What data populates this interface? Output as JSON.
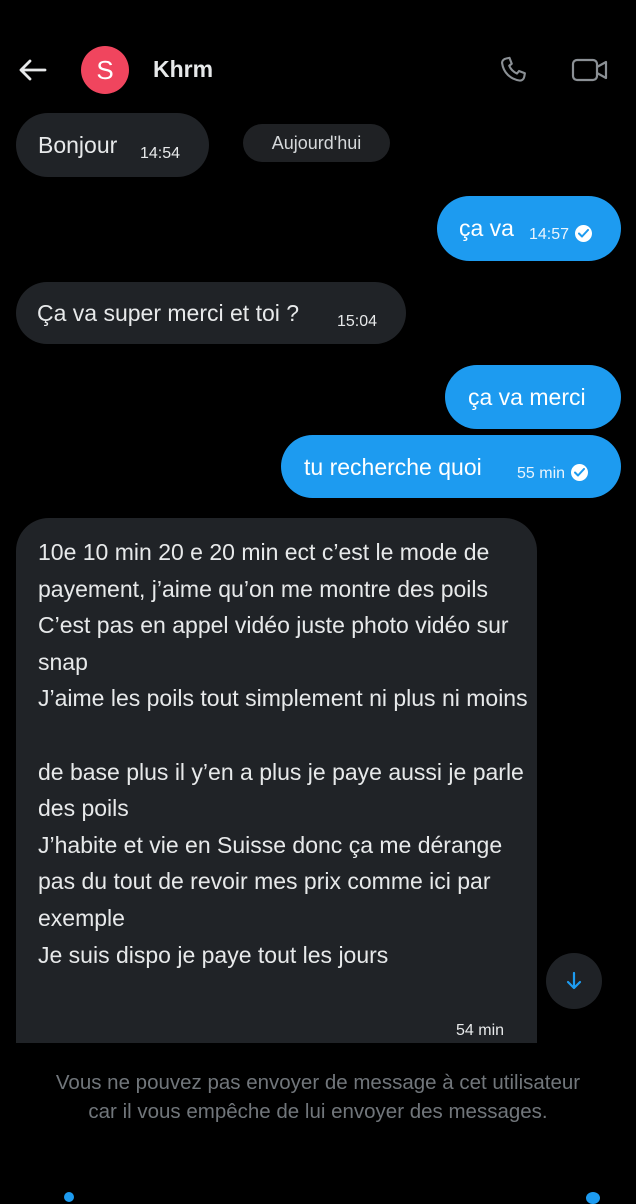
{
  "header": {
    "avatar_letter": "S",
    "contact_name": "Khrm",
    "back_icon": "arrow-left-icon",
    "call_icon": "phone-icon",
    "video_icon": "video-camera-icon"
  },
  "date_divider": "Aujourd'hui",
  "messages": [
    {
      "side": "incoming",
      "text": "Bonjour",
      "time": "14:54"
    },
    {
      "side": "outgoing",
      "text": "ça va",
      "time": "14:57",
      "read": true
    },
    {
      "side": "incoming",
      "text": "Ça va super merci et toi ?",
      "time": "15:04"
    },
    {
      "side": "outgoing",
      "text": "ça va merci",
      "time": ""
    },
    {
      "side": "outgoing",
      "text": "tu recherche quoi",
      "time": "55 min",
      "read": true
    },
    {
      "side": "incoming",
      "text": "10e 10  min 20 e 20 min ect c’est le mode de payement,  j’aime qu’on me montre des poils\nC’est pas en appel vidéo juste photo vidéo sur snap\nJ’aime les poils tout simplement ni plus ni moins\n\nde base plus il y’en a plus je paye aussi je parle des poils\nJ’habite et vie en Suisse donc ça me dérange pas du tout de revoir mes prix comme ici par exemple\nJe suis dispo je paye tout les jours",
      "time": "54 min"
    }
  ],
  "blocked_notice": "Vous ne pouvez pas envoyer de message à cet utilisateur car il vous empêche de lui envoyer des messages.",
  "colors": {
    "background": "#000000",
    "incoming_bubble": "#202327",
    "outgoing_bubble": "#1d9bf0",
    "avatar": "#f0455e",
    "muted_text": "#71767b"
  }
}
